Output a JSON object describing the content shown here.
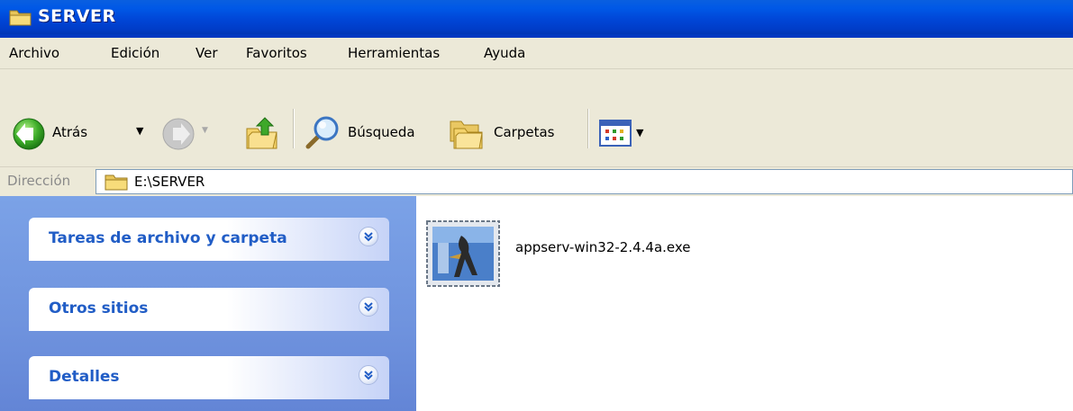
{
  "window": {
    "title": "SERVER"
  },
  "menu": {
    "items": [
      "Archivo",
      "Edición",
      "Ver",
      "Favoritos",
      "Herramientas",
      "Ayuda"
    ]
  },
  "toolbar": {
    "back_label": "Atrás",
    "search_label": "Búsqueda",
    "folders_label": "Carpetas"
  },
  "address": {
    "label": "Dirección",
    "value": "E:\\SERVER"
  },
  "taskpane": {
    "panels": [
      {
        "title": "Tareas de archivo y carpeta"
      },
      {
        "title": "Otros sitios"
      },
      {
        "title": "Detalles"
      }
    ]
  },
  "files": [
    {
      "name": "appserv-win32-2.4.4a.exe",
      "icon": "installer-exe-icon"
    }
  ],
  "colors": {
    "titlebar": "#0054e3",
    "taskpane_bg": "#7ba2e7",
    "panel_title": "#215dc6",
    "chrome": "#ece9d8"
  }
}
